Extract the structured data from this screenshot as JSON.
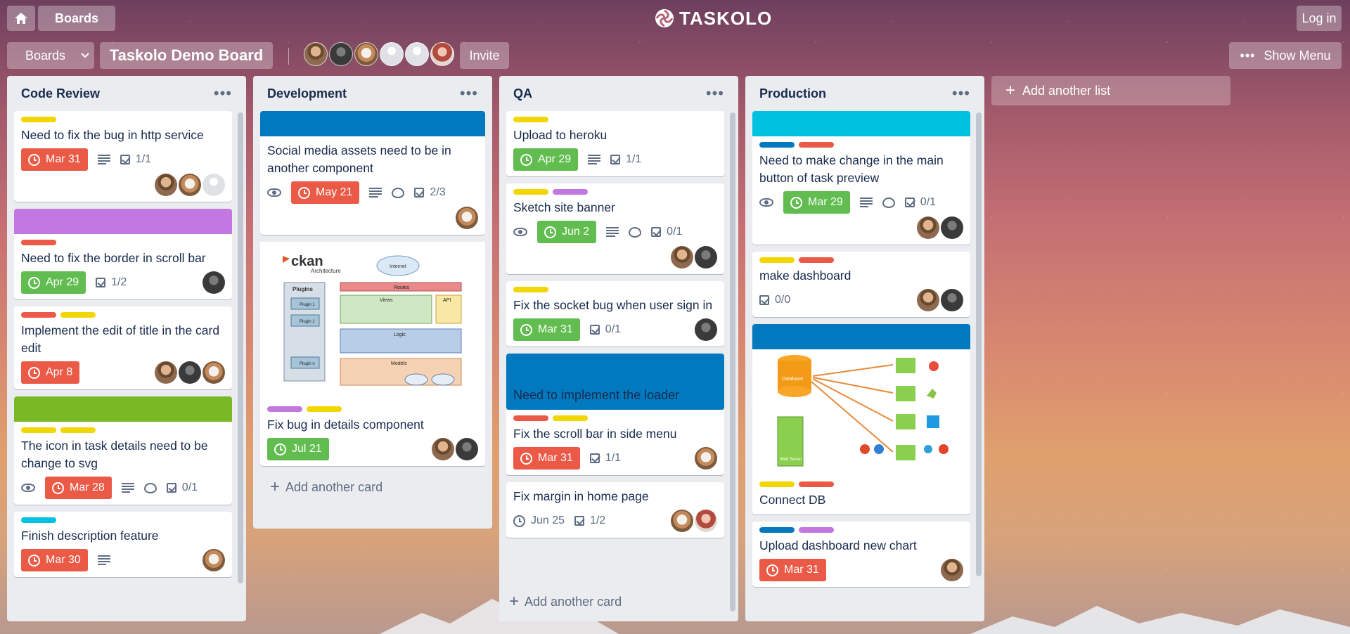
{
  "topbar": {
    "boards_label": "Boards",
    "logo_text": "TASKOLO",
    "login_label": "Log in"
  },
  "board": {
    "boards_label": "Boards",
    "title": "Taskolo Demo Board",
    "invite_label": "Invite",
    "show_menu_label": "Show Menu"
  },
  "add_list_label": "Add another list",
  "add_card_label": "Add another card",
  "colors": {
    "yellow": "#f2d600",
    "red": "#eb5a46",
    "purple": "#c377e0",
    "green": "#61bd4f",
    "blue": "#0079bf",
    "sky": "#00c2e0",
    "lime": "#7ab926"
  },
  "lists": [
    {
      "title": "Code Review",
      "cards": [
        {
          "title": "Need to fix the bug in http service",
          "due": "Mar 31",
          "checklist": "1/1"
        },
        {
          "title": "Need to fix the border in scroll bar",
          "due": "Apr 29",
          "checklist": "1/2"
        },
        {
          "title": "Implement the edit of title in the card edit",
          "due": "Apr 8"
        },
        {
          "title": "The icon in task details need to be change to svg",
          "due": "Mar 28",
          "checklist": "0/1"
        },
        {
          "title": "Finish description feature",
          "due": "Mar 30"
        }
      ]
    },
    {
      "title": "Development",
      "cards": [
        {
          "title": "Social media assets need to be in another component",
          "due": "May 21",
          "checklist": "2/3"
        },
        {
          "title": "Fix bug in details component",
          "due": "Jul 21"
        }
      ],
      "image_texts": {
        "brand": "ckan",
        "subtitle": "Architecture",
        "internet": "Internet",
        "plugins": "Plugins",
        "plugin1": "Plugin 1",
        "plugin2": "Plugin 2",
        "pluginn": "Plugin n",
        "routes": "Routes",
        "views": "Views",
        "api": "API",
        "logic": "Logic",
        "models": "Models"
      }
    },
    {
      "title": "QA",
      "cards": [
        {
          "title": "Upload to heroku",
          "due": "Apr 29",
          "checklist": "1/1"
        },
        {
          "title": "Sketch site banner",
          "due": "Jun 2",
          "checklist": "0/1"
        },
        {
          "title": "Fix the socket bug when user sign in",
          "due": "Mar 31",
          "checklist": "0/1"
        },
        {
          "cover_title": "Need to implement the loader"
        },
        {
          "title": "Fix the scroll bar in side menu",
          "due": "Mar 31",
          "checklist": "1/1"
        },
        {
          "title": "Fix margin in home page",
          "due": "Jun 25",
          "checklist": "1/2"
        }
      ]
    },
    {
      "title": "Production",
      "cards": [
        {
          "title": "Need to make change in the main button of task preview",
          "due": "Mar 29",
          "checklist": "0/1"
        },
        {
          "title": "make dashboard",
          "checklist": "0/0"
        },
        {
          "title": "Connect DB"
        },
        {
          "title": "Upload dashboard new chart",
          "due": "Mar 31"
        }
      ],
      "image_texts": {
        "database": "Database",
        "web_server": "Web Server"
      }
    }
  ]
}
